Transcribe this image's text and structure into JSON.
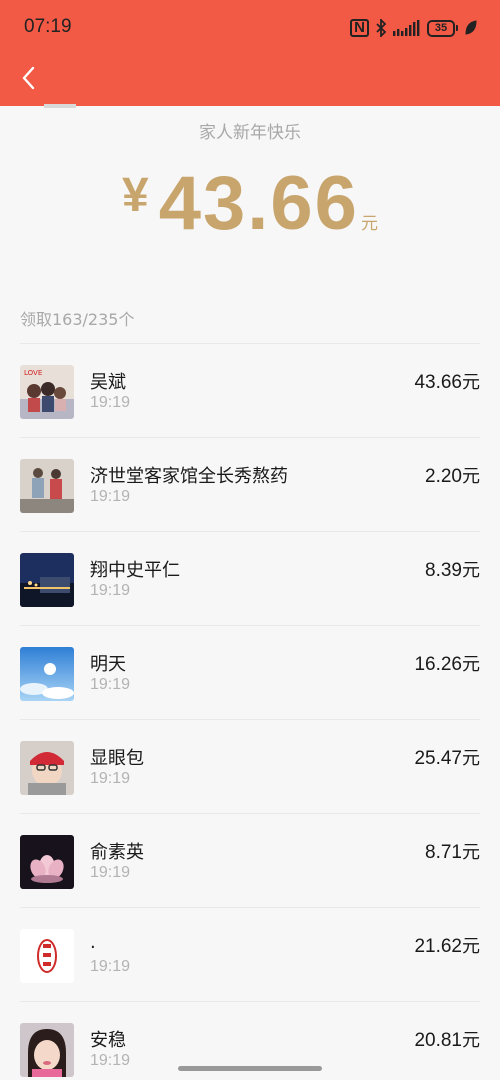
{
  "status_bar": {
    "time": "07:19",
    "nfc": "N",
    "battery": "35"
  },
  "header": {
    "back_icon": "chevron-left-icon",
    "background": "#f35a46"
  },
  "summary": {
    "wish": "家人新年快乐",
    "currency_symbol": "¥",
    "amount": "43.66",
    "unit": "元",
    "amount_color": "#c8a56d"
  },
  "claimed_count": "领取163/235个",
  "records": [
    {
      "name": "吴斌",
      "time": "19:19",
      "amount": "43.66",
      "unit": "元",
      "avatar": "family-photo"
    },
    {
      "name": "济世堂客家馆全长秀熬药",
      "time": "19:19",
      "amount": "2.20",
      "unit": "元",
      "avatar": "two-people-photo"
    },
    {
      "name": "翔中史平仁",
      "time": "19:19",
      "amount": "8.39",
      "unit": "元",
      "avatar": "night-building-photo"
    },
    {
      "name": "明天",
      "time": "19:19",
      "amount": "16.26",
      "unit": "元",
      "avatar": "sky-sun-photo"
    },
    {
      "name": "显眼包",
      "time": "19:19",
      "amount": "25.47",
      "unit": "元",
      "avatar": "child-red-hat-photo"
    },
    {
      "name": "俞素英",
      "time": "19:19",
      "amount": "8.71",
      "unit": "元",
      "avatar": "lotus-flower-photo"
    },
    {
      "name": ".",
      "time": "19:19",
      "amount": "21.62",
      "unit": "元",
      "avatar": "red-seal-stamp"
    },
    {
      "name": "安稳",
      "time": "19:19",
      "amount": "20.81",
      "unit": "元",
      "avatar": "child-portrait-photo"
    }
  ]
}
